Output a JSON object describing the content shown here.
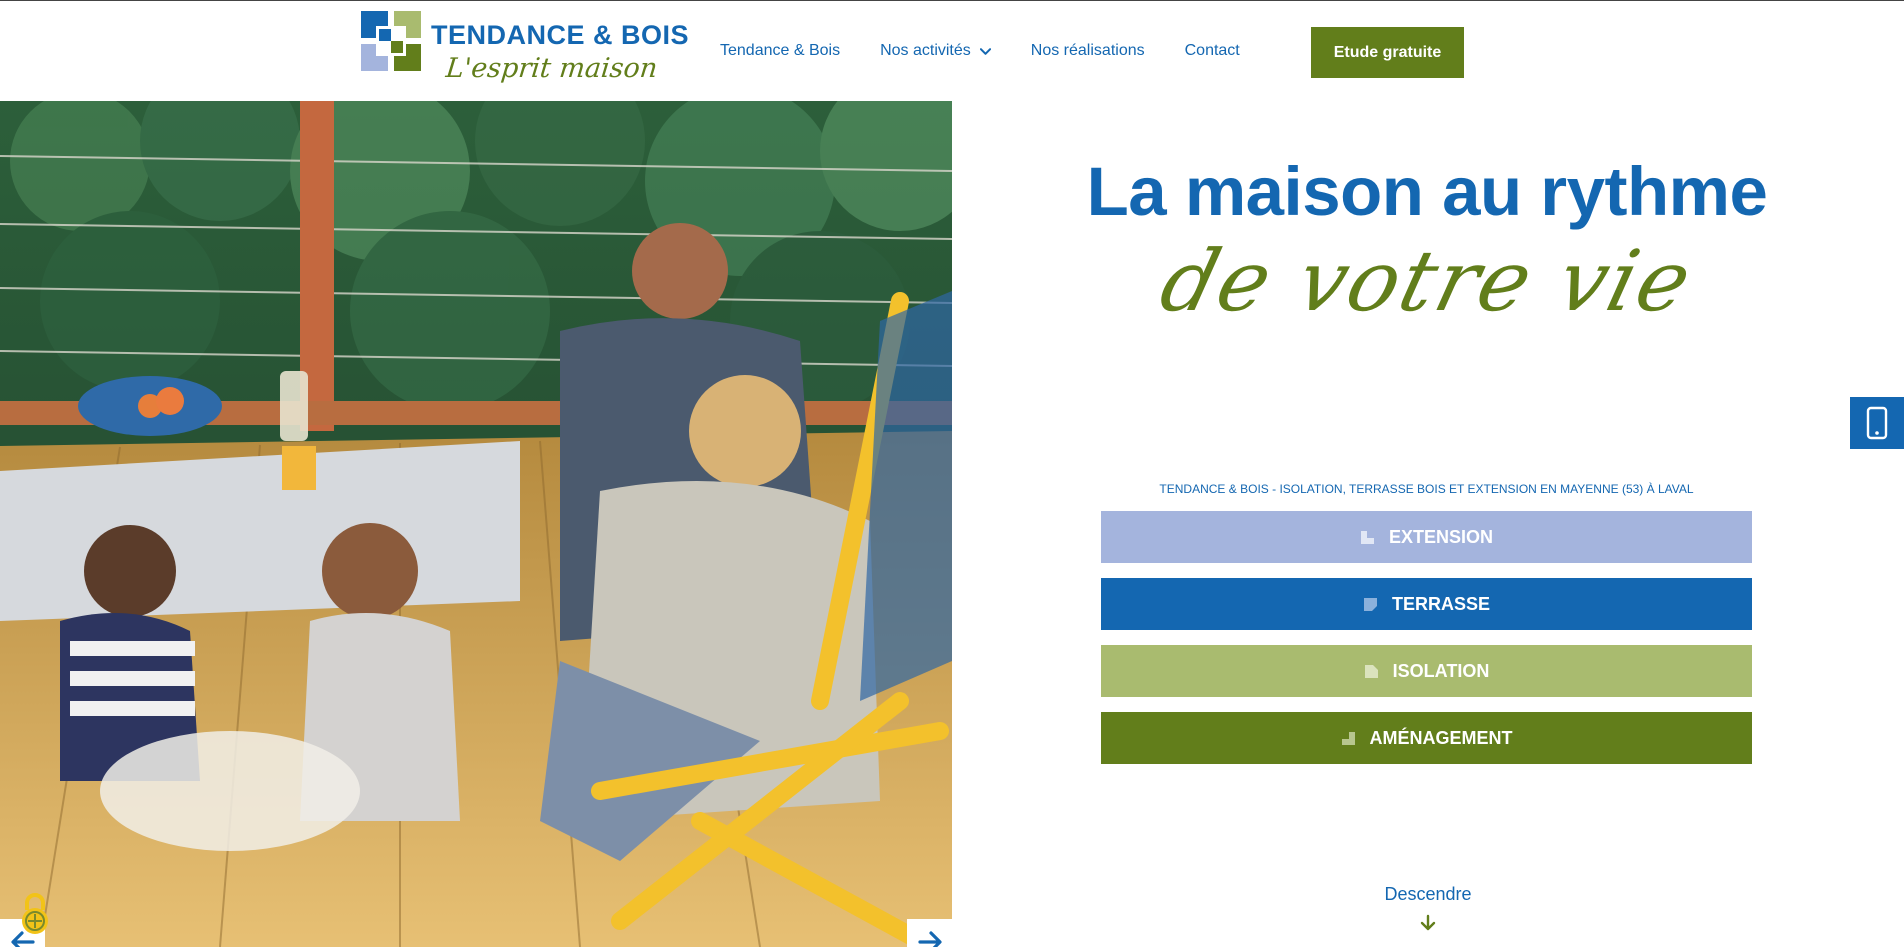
{
  "brand": {
    "name": "TENDANCE & BOIS",
    "tagline": "L'esprit maison"
  },
  "nav": {
    "items": [
      {
        "label": "Tendance & Bois"
      },
      {
        "label": "Nos activités"
      },
      {
        "label": "Nos réalisations"
      },
      {
        "label": "Contact"
      }
    ],
    "cta": "Etude gratuite"
  },
  "hero": {
    "headline": "La maison au rythme",
    "script": "de votre vie",
    "subtitle": "TENDANCE & BOIS - ISOLATION, TERRASSE BOIS ET EXTENSION EN MAYENNE (53) À LAVAL"
  },
  "services": [
    {
      "label": "EXTENSION",
      "color": "#a4b4dd"
    },
    {
      "label": "TERRASSE",
      "color": "#1467b1"
    },
    {
      "label": "ISOLATION",
      "color": "#a9bb6f"
    },
    {
      "label": "AMÉNAGEMENT",
      "color": "#627e1b"
    }
  ],
  "scroll": {
    "label": "Descendre"
  },
  "colors": {
    "blue": "#1467b1",
    "green": "#627e1b",
    "light_blue": "#a4b4dd",
    "light_green": "#a9bb6f"
  },
  "icons": [
    "logo-mark",
    "chevron-down-icon",
    "arrow-left-icon",
    "arrow-right-icon",
    "lock-icon",
    "phone-icon",
    "arrow-down-icon"
  ]
}
